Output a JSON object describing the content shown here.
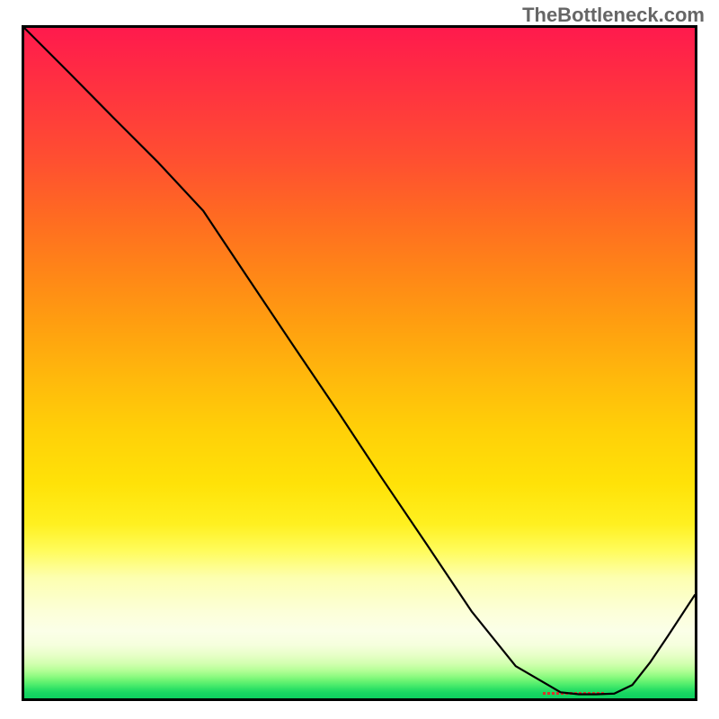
{
  "watermark": "TheBottleneck.com",
  "chart_data": {
    "type": "line",
    "title": "",
    "xlabel": "",
    "ylabel": "",
    "xlim": [
      0,
      100
    ],
    "ylim": [
      0,
      100
    ],
    "grid": false,
    "legend": false,
    "notes": "Values are estimated from pixel positions relative to the framed plot area; axes are unlabeled in the source image. Background is a vertical rainbow gradient (red at top through yellow to green at bottom). A small dashed red segment sits at the curve's minimum.",
    "series": [
      {
        "name": "black-curve",
        "color": "#000000",
        "style": "solid",
        "x": [
          0.0,
          6.7,
          13.3,
          20.0,
          26.7,
          33.3,
          40.0,
          46.7,
          53.3,
          60.0,
          66.7,
          73.3,
          80.0,
          82.7,
          85.3,
          88.0,
          90.7,
          93.3,
          96.0,
          100.0
        ],
        "y": [
          100.0,
          93.3,
          86.6,
          79.9,
          72.7,
          62.8,
          52.8,
          42.9,
          32.9,
          23.0,
          13.0,
          4.8,
          0.9,
          0.6,
          0.6,
          0.7,
          2.0,
          5.3,
          9.3,
          15.4
        ]
      },
      {
        "name": "red-min-marker",
        "color": "#d93326",
        "style": "dashed",
        "x": [
          77.3,
          86.7
        ],
        "y": [
          0.8,
          0.8
        ]
      }
    ],
    "gradient_stops": [
      {
        "pos": 0.0,
        "color": "#ff1a4d"
      },
      {
        "pos": 0.2,
        "color": "#ff5030"
      },
      {
        "pos": 0.44,
        "color": "#ff9e10"
      },
      {
        "pos": 0.68,
        "color": "#ffe208"
      },
      {
        "pos": 0.87,
        "color": "#fcffd8"
      },
      {
        "pos": 0.96,
        "color": "#94fb84"
      },
      {
        "pos": 1.0,
        "color": "#0ecf5f"
      }
    ]
  }
}
